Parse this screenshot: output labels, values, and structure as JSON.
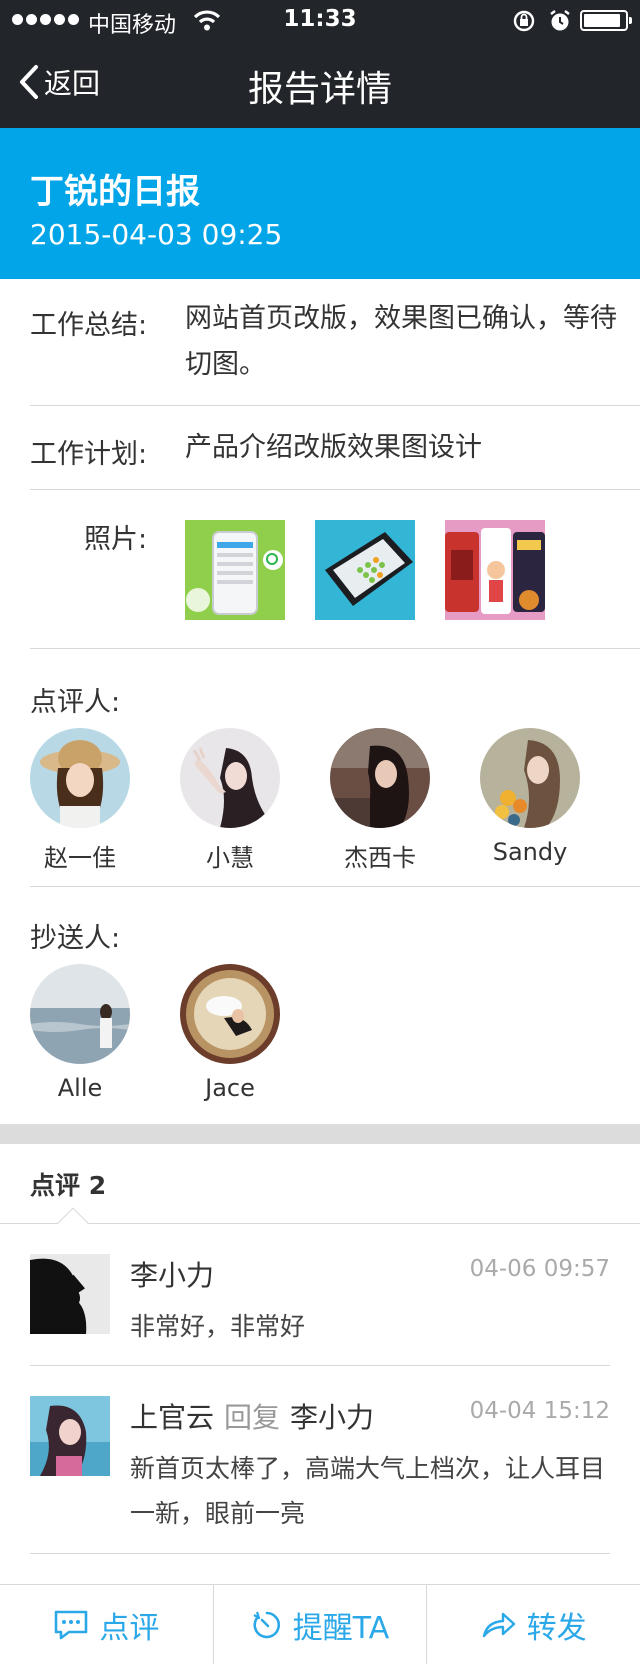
{
  "status_bar": {
    "carrier": "中国移动",
    "time": "11:33",
    "battery_level": 0.9
  },
  "nav": {
    "back_label": "返回",
    "title": "报告详情"
  },
  "report": {
    "title": "丁锐的日报",
    "datetime": "2015-04-03 09:25",
    "summary_label": "工作总结:",
    "summary_value": "网站首页改版，效果图已确认，等待切图。",
    "plan_label": "工作计划:",
    "plan_value": "产品介绍改版效果图设计",
    "photos_label": "照片:"
  },
  "reviewers": {
    "label": "点评人:",
    "people": [
      "赵一佳",
      "小慧",
      "杰西卡",
      "Sandy"
    ]
  },
  "cc": {
    "label": "抄送人:",
    "people": [
      "Alle",
      "Jace"
    ]
  },
  "comments": {
    "header": "点评 2",
    "items": [
      {
        "name": "李小力",
        "time": "04-06 09:57",
        "text": "非常好，非常好"
      },
      {
        "name": "上官云",
        "reply_word": "回复",
        "reply_to": "李小力",
        "time": "04-04 15:12",
        "text": "新首页太棒了，高端大气上档次，让人耳目一新，眼前一亮"
      }
    ]
  },
  "toolbar": {
    "comment_label": "点评",
    "remind_label": "提醒TA",
    "forward_label": "转发"
  },
  "colors": {
    "header_blue": "#02a5e8",
    "nav_dark": "#22262a",
    "accent": "#2ba8e8"
  }
}
